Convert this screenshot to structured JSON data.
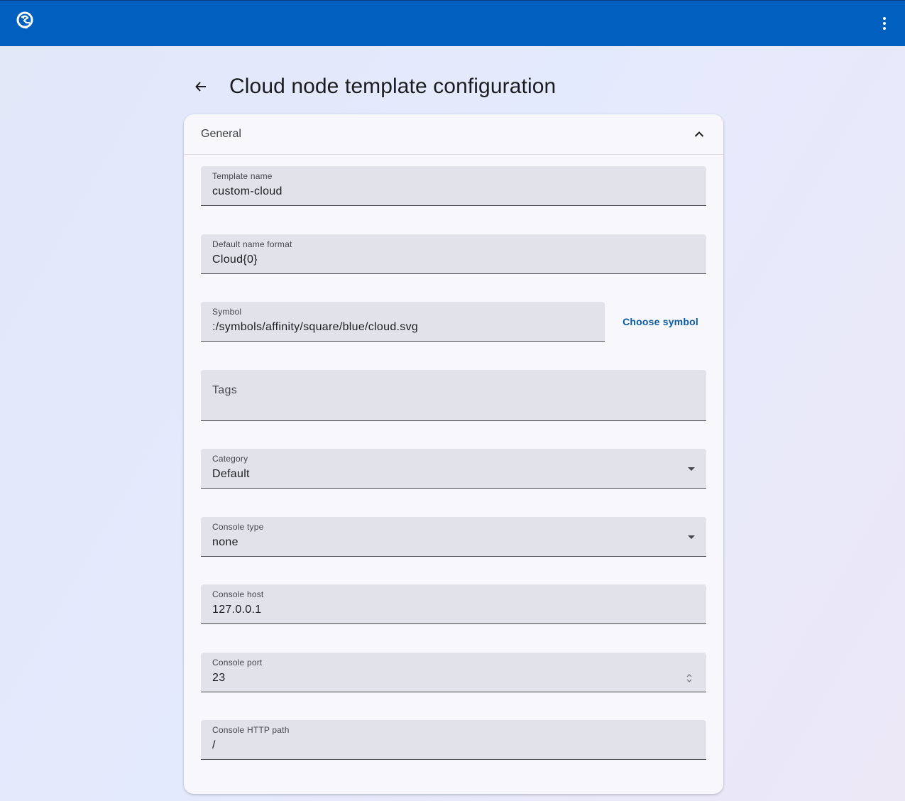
{
  "app": {
    "logo_icon": "gns3-chameleon-logo-icon",
    "menu_icon": "more-vert-icon"
  },
  "page": {
    "title": "Cloud node template configuration",
    "back_icon": "arrow-back-icon"
  },
  "section": {
    "label": "General",
    "expanded": true,
    "toggle_icon": "chevron-up-icon"
  },
  "fields": {
    "template_name": {
      "label": "Template name",
      "value": "custom-cloud"
    },
    "default_name_format": {
      "label": "Default name format",
      "value": "Cloud{0}"
    },
    "symbol": {
      "label": "Symbol",
      "value": ":/symbols/affinity/square/blue/cloud.svg"
    },
    "choose_symbol_label": "Choose symbol",
    "tags": {
      "label": "Tags",
      "value": ""
    },
    "category": {
      "label": "Category",
      "value": "Default"
    },
    "console_type": {
      "label": "Console type",
      "value": "none"
    },
    "console_host": {
      "label": "Console host",
      "value": "127.0.0.1"
    },
    "console_port": {
      "label": "Console port",
      "value": "23"
    },
    "console_http_path": {
      "label": "Console HTTP path",
      "value": "/"
    }
  },
  "colors": {
    "topbar": "#005fbf",
    "accent_link": "#0b5aa8",
    "card_bg": "#f8f8fc",
    "field_bg": "#e2e3ea"
  }
}
